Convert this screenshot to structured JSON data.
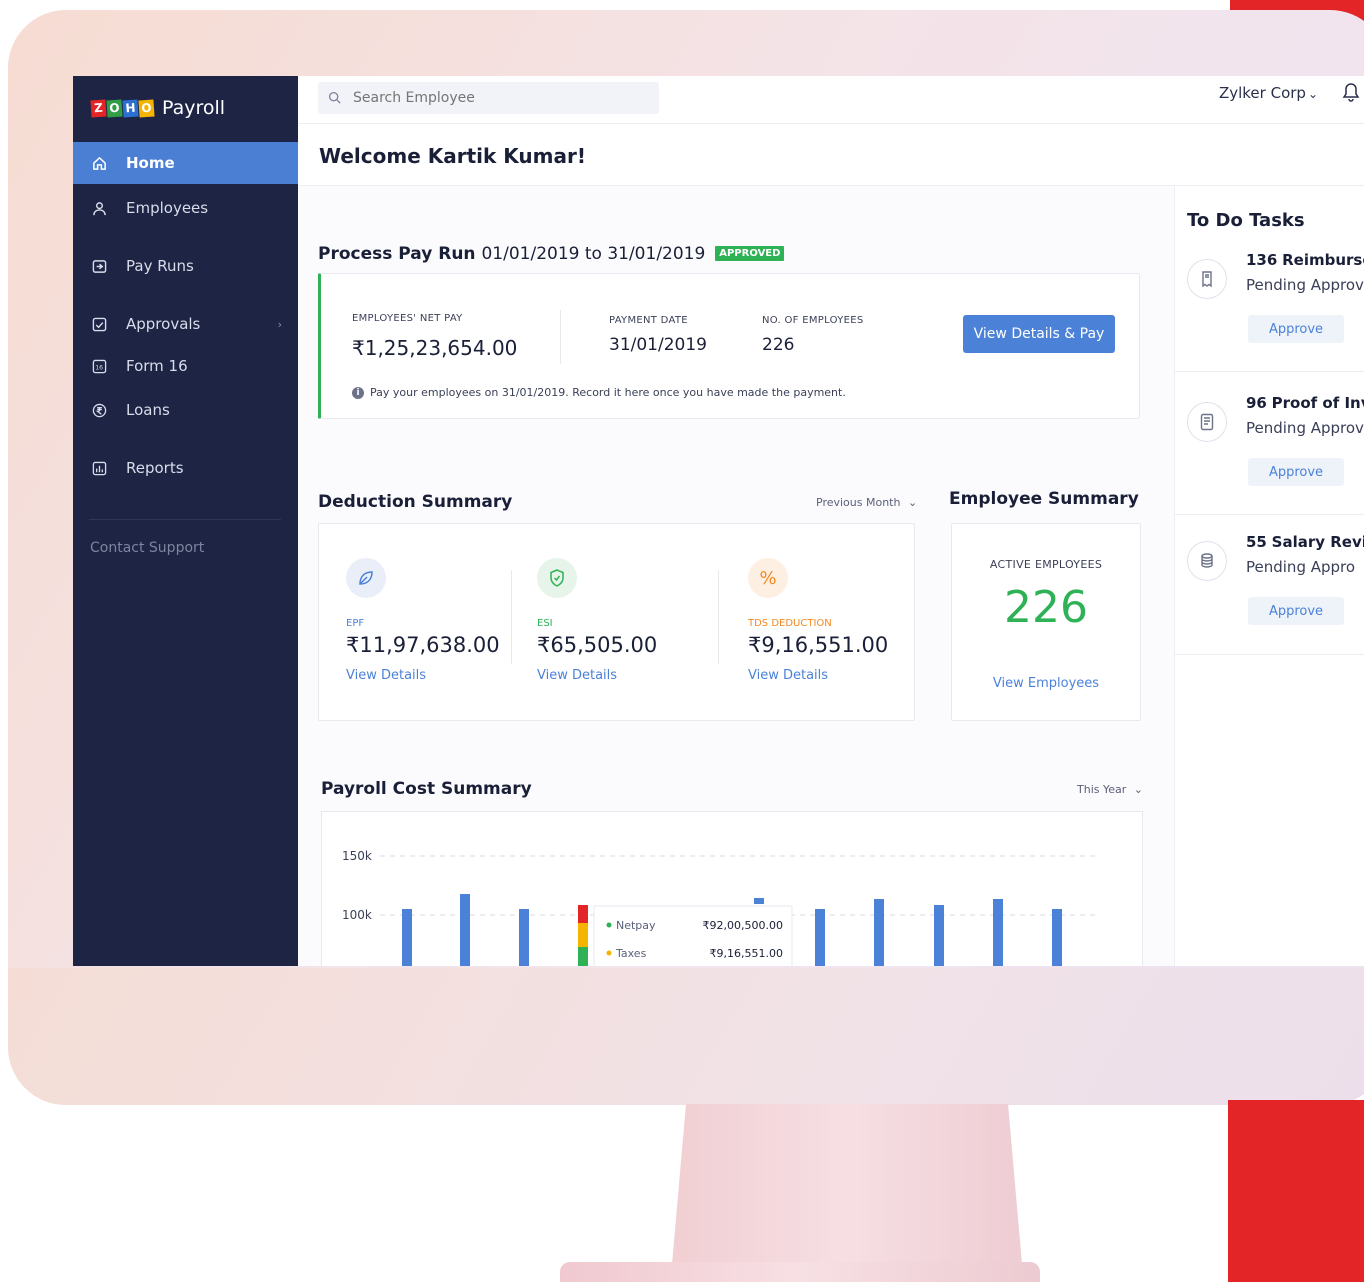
{
  "app": {
    "logo_letters": [
      "Z",
      "O",
      "H",
      "O"
    ],
    "logo_colors": [
      "#e42527",
      "#2f9e44",
      "#2b6fd1",
      "#f5b400"
    ],
    "product_name": "Payroll"
  },
  "sidebar": {
    "items": [
      {
        "label": "Home",
        "icon": "home-icon",
        "active": true
      },
      {
        "label": "Employees",
        "icon": "user-icon",
        "active": false
      },
      {
        "label": "Pay Runs",
        "icon": "payrun-icon",
        "active": false
      },
      {
        "label": "Approvals",
        "icon": "checkbox-icon",
        "active": false,
        "has_submenu": true
      },
      {
        "label": "Form 16",
        "icon": "form16-icon",
        "active": false
      },
      {
        "label": "Loans",
        "icon": "rupee-circle-icon",
        "active": false
      },
      {
        "label": "Reports",
        "icon": "reports-icon",
        "active": false
      }
    ],
    "contact_support": "Contact Support"
  },
  "header": {
    "search_placeholder": "Search Employee",
    "organization": "Zylker Corp",
    "organization_caret": "⌄"
  },
  "welcome": "Welcome Kartik Kumar!",
  "pay_run": {
    "title": "Process Pay Run",
    "period": "01/01/2019 to 31/01/2019",
    "status": "APPROVED",
    "net_pay_label": "EMPLOYEES' NET PAY",
    "net_pay_value": "₹1,25,23,654.00",
    "payment_date_label": "PAYMENT DATE",
    "payment_date_value": "31/01/2019",
    "employees_label": "NO. OF EMPLOYEES",
    "employees_value": "226",
    "action_label": "View Details & Pay",
    "note": "Pay your employees on 31/01/2019. Record it here once you have made the payment."
  },
  "deduction_summary": {
    "title": "Deduction Summary",
    "filter": "Previous Month",
    "items": [
      {
        "label": "EPF",
        "value": "₹11,97,638.00",
        "link": "View Details",
        "color": "#4b82d8",
        "bg": "#e9eef8",
        "icon": "leaf-icon"
      },
      {
        "label": "ESI",
        "value": "₹65,505.00",
        "link": "View Details",
        "color": "#2fb156",
        "bg": "#e6f4ea",
        "icon": "shield-icon"
      },
      {
        "label": "TDS DEDUCTION",
        "value": "₹9,16,551.00",
        "link": "View Details",
        "color": "#f08a24",
        "bg": "#fdf0e3",
        "icon": "percent-icon",
        "glyph": "%"
      }
    ]
  },
  "employee_summary": {
    "title": "Employee Summary",
    "active_label": "ACTIVE EMPLOYEES",
    "active_value": "226",
    "link": "View Employees"
  },
  "payroll_cost": {
    "title": "Payroll Cost Summary",
    "filter": "This Year"
  },
  "chart_data": {
    "type": "bar",
    "title": "Payroll Cost Summary",
    "y_ticks": [
      "150k",
      "100k"
    ],
    "grid": true,
    "series": [
      {
        "name": "Netpay",
        "color": "#4b82d8"
      },
      {
        "name": "Taxes",
        "color": "#f5b400"
      }
    ],
    "tooltip": {
      "rows": [
        {
          "label": "Netpay",
          "value": "₹92,00,500.00",
          "color": "#2fb156"
        },
        {
          "label": "Taxes",
          "value": "₹9,16,551.00",
          "color": "#f5b400"
        }
      ]
    }
  },
  "todo": {
    "title": "To Do Tasks",
    "tasks": [
      {
        "count": "136",
        "title": "Reimbursem",
        "subtitle": "Pending Approv",
        "action": "Approve",
        "icon": "reimbursement-icon"
      },
      {
        "count": "96",
        "title": "Proof of Inve",
        "subtitle": "Pending Approv",
        "action": "Approve",
        "icon": "document-icon"
      },
      {
        "count": "55",
        "title": "Salary Revis",
        "subtitle": "Pending Appro",
        "action": "Approve",
        "icon": "coins-icon"
      }
    ]
  }
}
